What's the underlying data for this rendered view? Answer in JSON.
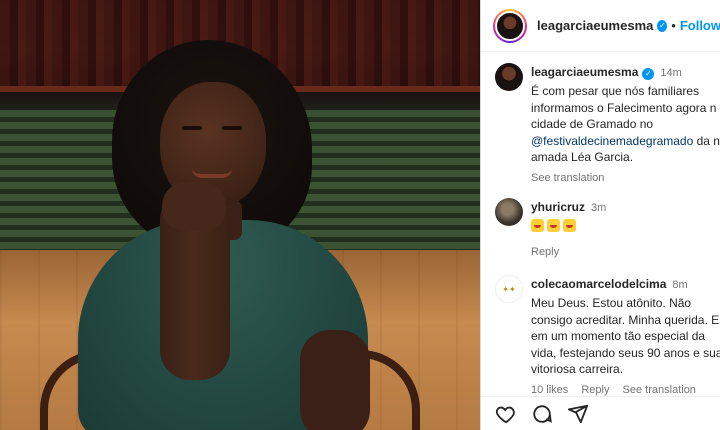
{
  "post": {
    "username": "leagarciaeumesma",
    "follow_label": "Follow",
    "dot": "•"
  },
  "comments": [
    {
      "username": "leagarciaeumesma",
      "time": "14m",
      "line1": "É com pesar que nós familiares",
      "line2": "informamos o Falecimento agora n",
      "line3": "cidade de Gramado no",
      "mention": "@festivaldecinemadegramado",
      "line4_rest": " da n",
      "line5": "amada Léa Garcia.",
      "see_translation": "See translation"
    },
    {
      "username": "yhuricruz",
      "time": "3m",
      "reply": "Reply"
    },
    {
      "username": "colecaomarcelodelcima",
      "time": "8m",
      "line1": "Meu Deus. Estou atônito. Não",
      "line2": "consigo acreditar. Minha querida. E",
      "line3": "em um momento tão especial da",
      "line4": "vida, festejando seus 90 anos e sua",
      "line5": "vitoriosa carreira.",
      "likes": "10 likes",
      "reply": "Reply",
      "see_translation": "See translation"
    }
  ],
  "icons": {
    "like": "heart-icon",
    "comment": "comment-icon",
    "share": "share-icon"
  },
  "colors": {
    "accent": "#0095f6",
    "mention": "#00376b"
  }
}
